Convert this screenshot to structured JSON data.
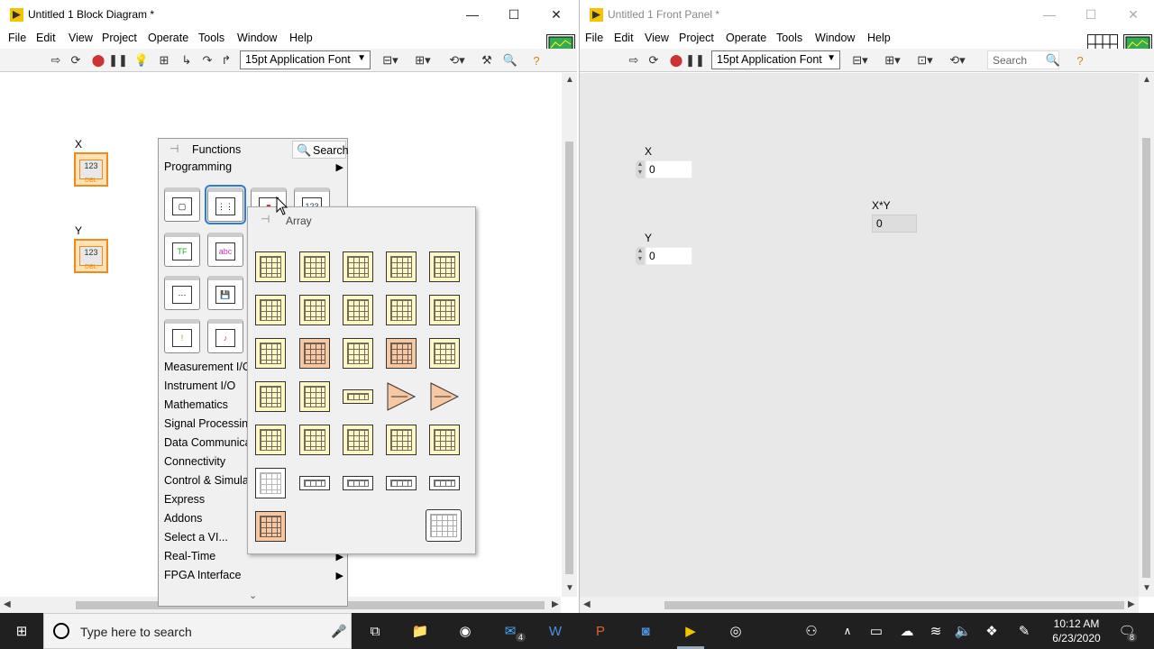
{
  "block_diagram": {
    "title": "Untitled 1 Block Diagram *",
    "menus": [
      "File",
      "Edit",
      "View",
      "Project",
      "Operate",
      "Tools",
      "Window",
      "Help"
    ],
    "font_select": "15pt Application Font",
    "terminals": [
      {
        "label": "X",
        "value": "123",
        "type": "DBL"
      },
      {
        "label": "Y",
        "value": "123",
        "type": "DBL"
      }
    ]
  },
  "front_panel": {
    "title": "Untitled 1 Front Panel *",
    "menus": [
      "File",
      "Edit",
      "View",
      "Project",
      "Operate",
      "Tools",
      "Window",
      "Help"
    ],
    "font_select": "15pt Application Font",
    "search_placeholder": "Search",
    "controls": [
      {
        "label": "X",
        "value": "0"
      },
      {
        "label": "Y",
        "value": "0"
      }
    ],
    "indicators": [
      {
        "label": "X*Y",
        "value": "0"
      }
    ]
  },
  "functions_palette": {
    "title": "Functions",
    "search_label": "Search",
    "current": "Programming",
    "top_icons": [
      "structures-icon",
      "array-icon",
      "cluster-icon",
      "numeric-icon",
      "boolean-icon",
      "string-icon",
      "comparison-icon",
      "timing-icon",
      "dialog-icon",
      "file-io-icon",
      "waveform-icon",
      "graphics-sound-icon"
    ],
    "categories": [
      {
        "label": "Measurement I/O",
        "arrow": true
      },
      {
        "label": "Instrument I/O",
        "arrow": true
      },
      {
        "label": "Mathematics",
        "arrow": true
      },
      {
        "label": "Signal Processing",
        "arrow": true
      },
      {
        "label": "Data Communication",
        "arrow": true
      },
      {
        "label": "Connectivity",
        "arrow": true
      },
      {
        "label": "Control & Simulation",
        "arrow": true
      },
      {
        "label": "Express",
        "arrow": true
      },
      {
        "label": "Addons",
        "arrow": true
      },
      {
        "label": "Select a VI...",
        "arrow": false
      },
      {
        "label": "Real-Time",
        "arrow": true
      },
      {
        "label": "FPGA Interface",
        "arrow": true
      }
    ]
  },
  "array_palette": {
    "title": "Array"
  },
  "taskbar": {
    "search_placeholder": "Type here to search",
    "mail_badge": "4",
    "time": "10:12 AM",
    "date": "6/23/2020",
    "notif_count": "8"
  }
}
